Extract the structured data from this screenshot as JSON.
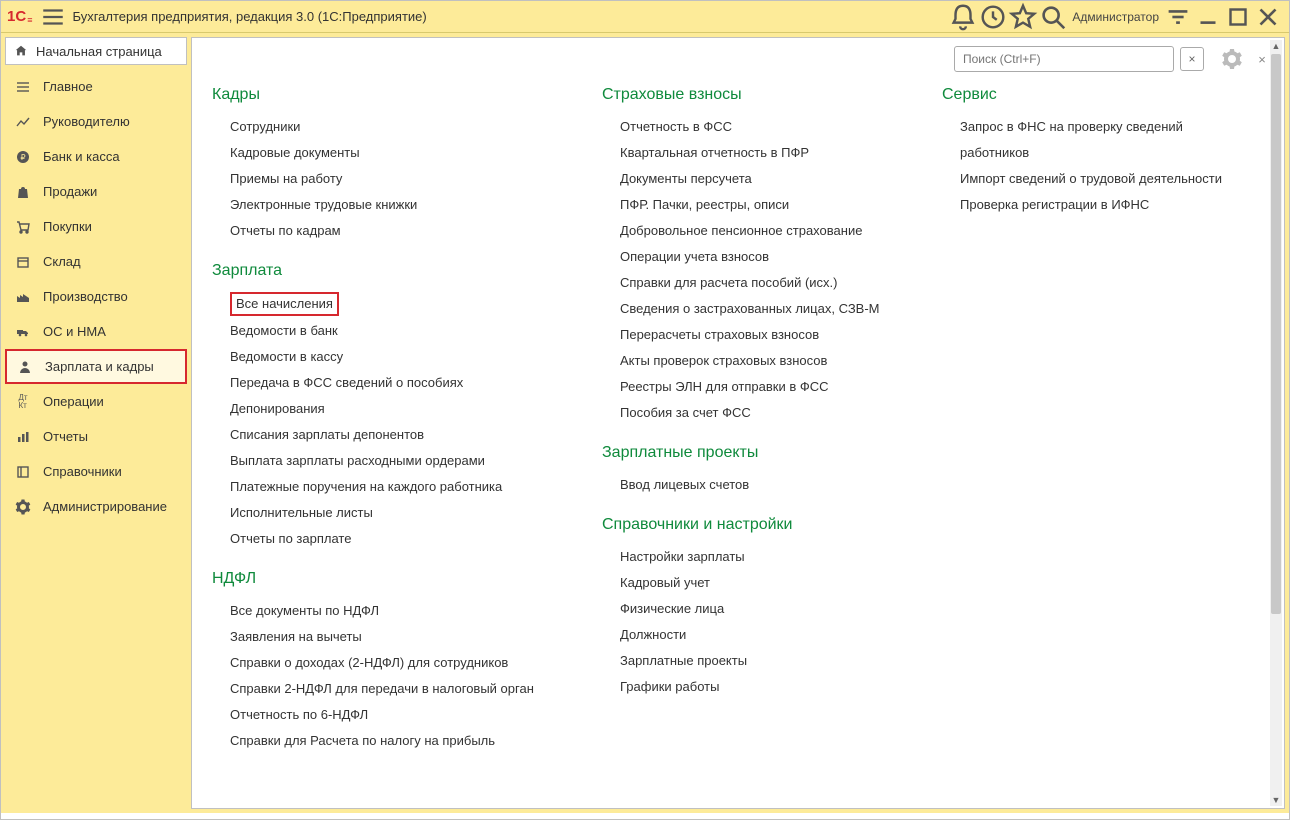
{
  "title": "Бухгалтерия предприятия, редакция 3.0  (1С:Предприятие)",
  "username": "Администратор",
  "startPage": "Начальная страница",
  "search": {
    "placeholder": "Поиск (Ctrl+F)"
  },
  "nav": [
    {
      "label": "Главное",
      "icon": "menu"
    },
    {
      "label": "Руководителю",
      "icon": "trend"
    },
    {
      "label": "Банк и касса",
      "icon": "ruble"
    },
    {
      "label": "Продажи",
      "icon": "bag"
    },
    {
      "label": "Покупки",
      "icon": "cart"
    },
    {
      "label": "Склад",
      "icon": "box"
    },
    {
      "label": "Производство",
      "icon": "factory"
    },
    {
      "label": "ОС и НМА",
      "icon": "truck"
    },
    {
      "label": "Зарплата и кадры",
      "icon": "person",
      "active": true
    },
    {
      "label": "Операции",
      "icon": "dtdk"
    },
    {
      "label": "Отчеты",
      "icon": "chart"
    },
    {
      "label": "Справочники",
      "icon": "book"
    },
    {
      "label": "Администрирование",
      "icon": "gear"
    }
  ],
  "columns": [
    {
      "sections": [
        {
          "heading": "Кадры",
          "links": [
            "Сотрудники",
            "Кадровые документы",
            "Приемы на работу",
            "Электронные трудовые книжки",
            "Отчеты по кадрам"
          ]
        },
        {
          "heading": "Зарплата",
          "links": [
            "Все начисления",
            "Ведомости в банк",
            "Ведомости в кассу",
            "Передача в ФСС сведений о пособиях",
            "Депонирования",
            "Списания зарплаты депонентов",
            "Выплата зарплаты расходными ордерами",
            "Платежные поручения на каждого работника",
            "Исполнительные листы",
            "Отчеты по зарплате"
          ],
          "highlight": 0
        },
        {
          "heading": "НДФЛ",
          "links": [
            "Все документы по НДФЛ",
            "Заявления на вычеты",
            "Справки о доходах (2-НДФЛ) для сотрудников",
            "Справки 2-НДФЛ для передачи в налоговый орган",
            "Отчетность по 6-НДФЛ",
            "Справки для Расчета по налогу на прибыль"
          ]
        }
      ]
    },
    {
      "sections": [
        {
          "heading": "Страховые взносы",
          "links": [
            "Отчетность в ФСС",
            "Квартальная отчетность в ПФР",
            "Документы персучета",
            "ПФР. Пачки, реестры, описи",
            "Добровольное пенсионное страхование",
            "Операции учета взносов",
            "Справки для расчета пособий (исх.)",
            "Сведения о застрахованных лицах, СЗВ-М",
            "Перерасчеты страховых взносов",
            "Акты проверок страховых взносов",
            "Реестры ЭЛН для отправки в ФСС",
            "Пособия за счет ФСС"
          ]
        },
        {
          "heading": "Зарплатные проекты",
          "links": [
            "Ввод лицевых счетов"
          ]
        },
        {
          "heading": "Справочники и настройки",
          "links": [
            "Настройки зарплаты",
            "Кадровый учет",
            "Физические лица",
            "Должности",
            "Зарплатные проекты",
            "Графики работы"
          ]
        }
      ]
    },
    {
      "sections": [
        {
          "heading": "Сервис",
          "links": [
            "Запрос в ФНС на проверку сведений работников",
            "Импорт сведений о трудовой деятельности",
            "Проверка регистрации в ИФНС"
          ]
        }
      ]
    }
  ]
}
